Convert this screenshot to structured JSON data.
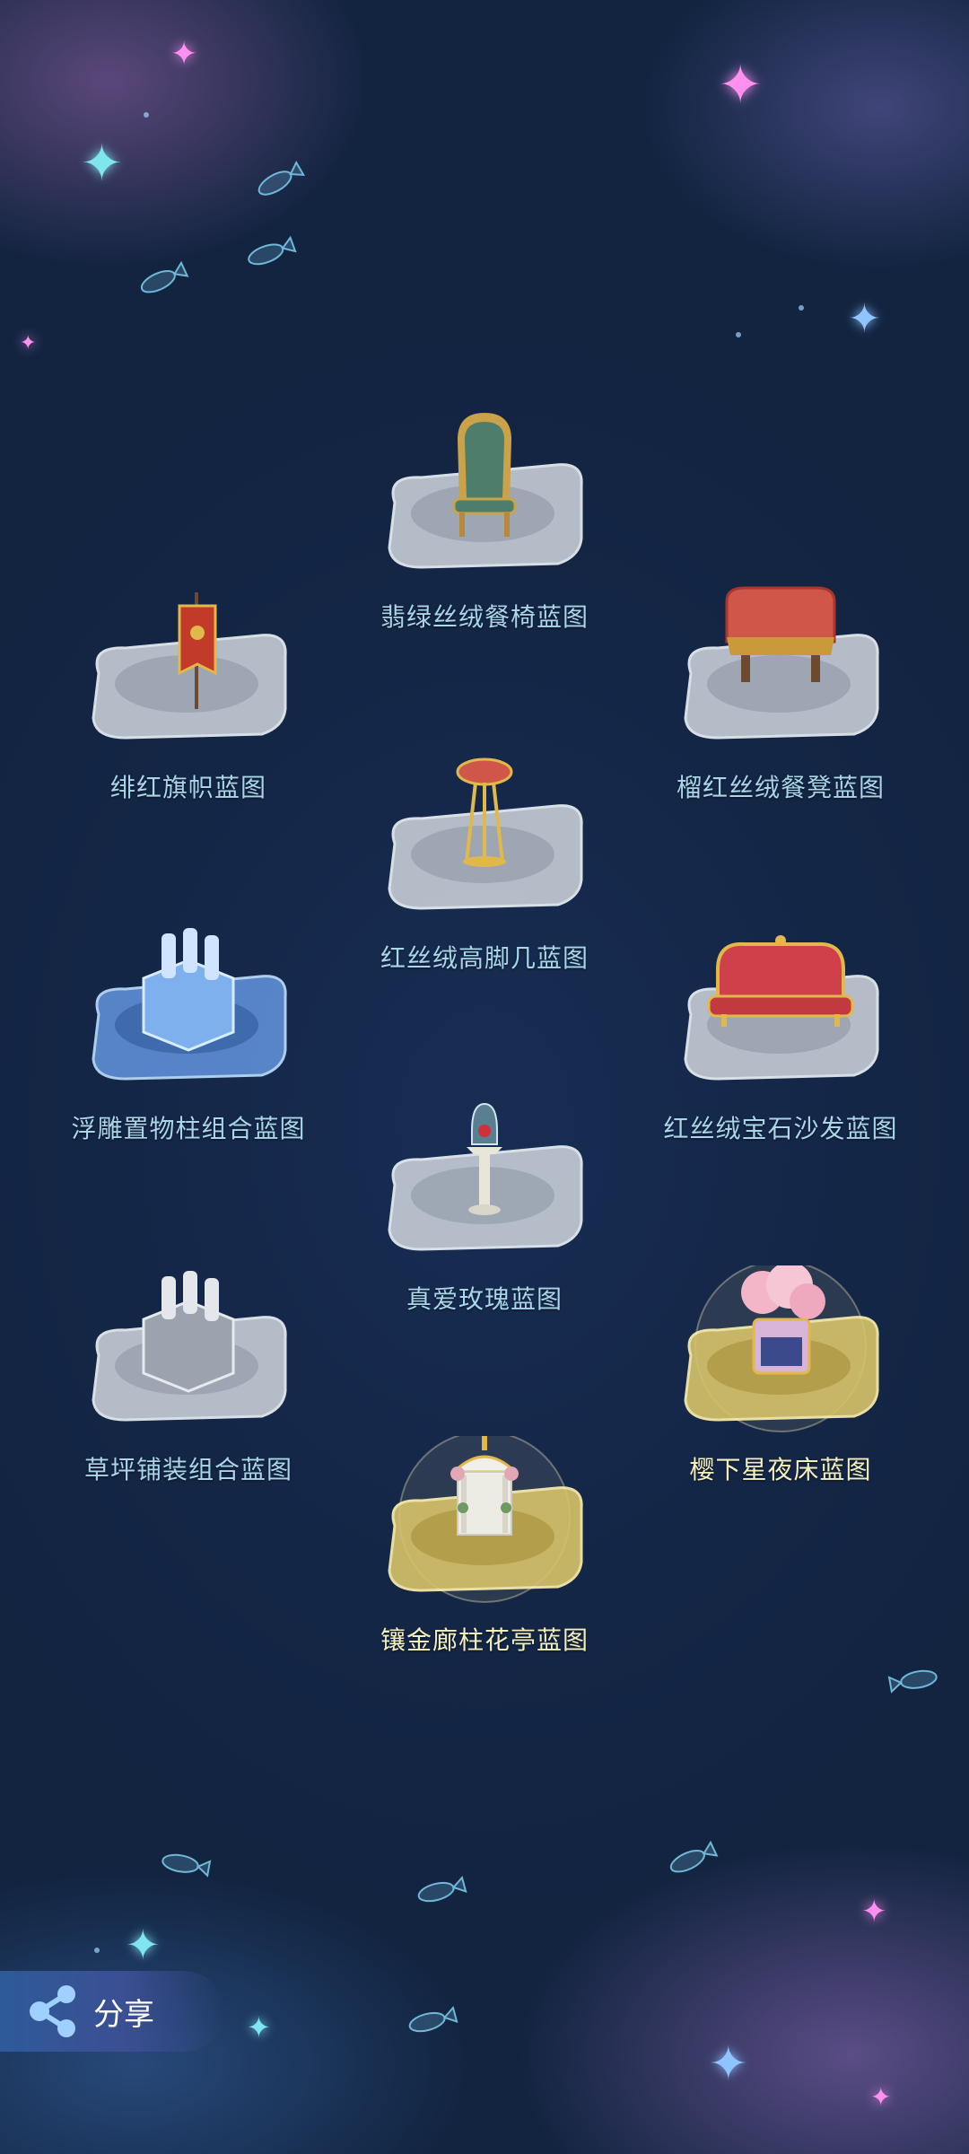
{
  "share": {
    "label": "分享",
    "icon": "share-icon"
  },
  "blueprints": [
    {
      "name": "翡绿丝绒餐椅蓝图",
      "icon": "green-velvet-chair-icon",
      "style": "silver"
    },
    {
      "name": "绯红旗帜蓝图",
      "icon": "crimson-banner-icon",
      "style": "silver"
    },
    {
      "name": "榴红丝绒餐凳蓝图",
      "icon": "red-velvet-stool-icon",
      "style": "silver"
    },
    {
      "name": "红丝绒高脚几蓝图",
      "icon": "red-velvet-side-table-icon",
      "style": "silver"
    },
    {
      "name": "浮雕置物柱组合蓝图",
      "icon": "relief-pillar-bundle-icon",
      "style": "blue"
    },
    {
      "name": "红丝绒宝石沙发蓝图",
      "icon": "red-velvet-gem-sofa-icon",
      "style": "silver"
    },
    {
      "name": "真爱玫瑰蓝图",
      "icon": "rose-dome-icon",
      "style": "silver"
    },
    {
      "name": "草坪铺装组合蓝图",
      "icon": "lawn-paving-bundle-icon",
      "style": "silver"
    },
    {
      "name": "樱下星夜床蓝图",
      "icon": "sakura-starry-bed-icon",
      "style": "gold"
    },
    {
      "name": "镶金廊柱花亭蓝图",
      "icon": "gilded-gazebo-icon",
      "style": "gold"
    }
  ]
}
